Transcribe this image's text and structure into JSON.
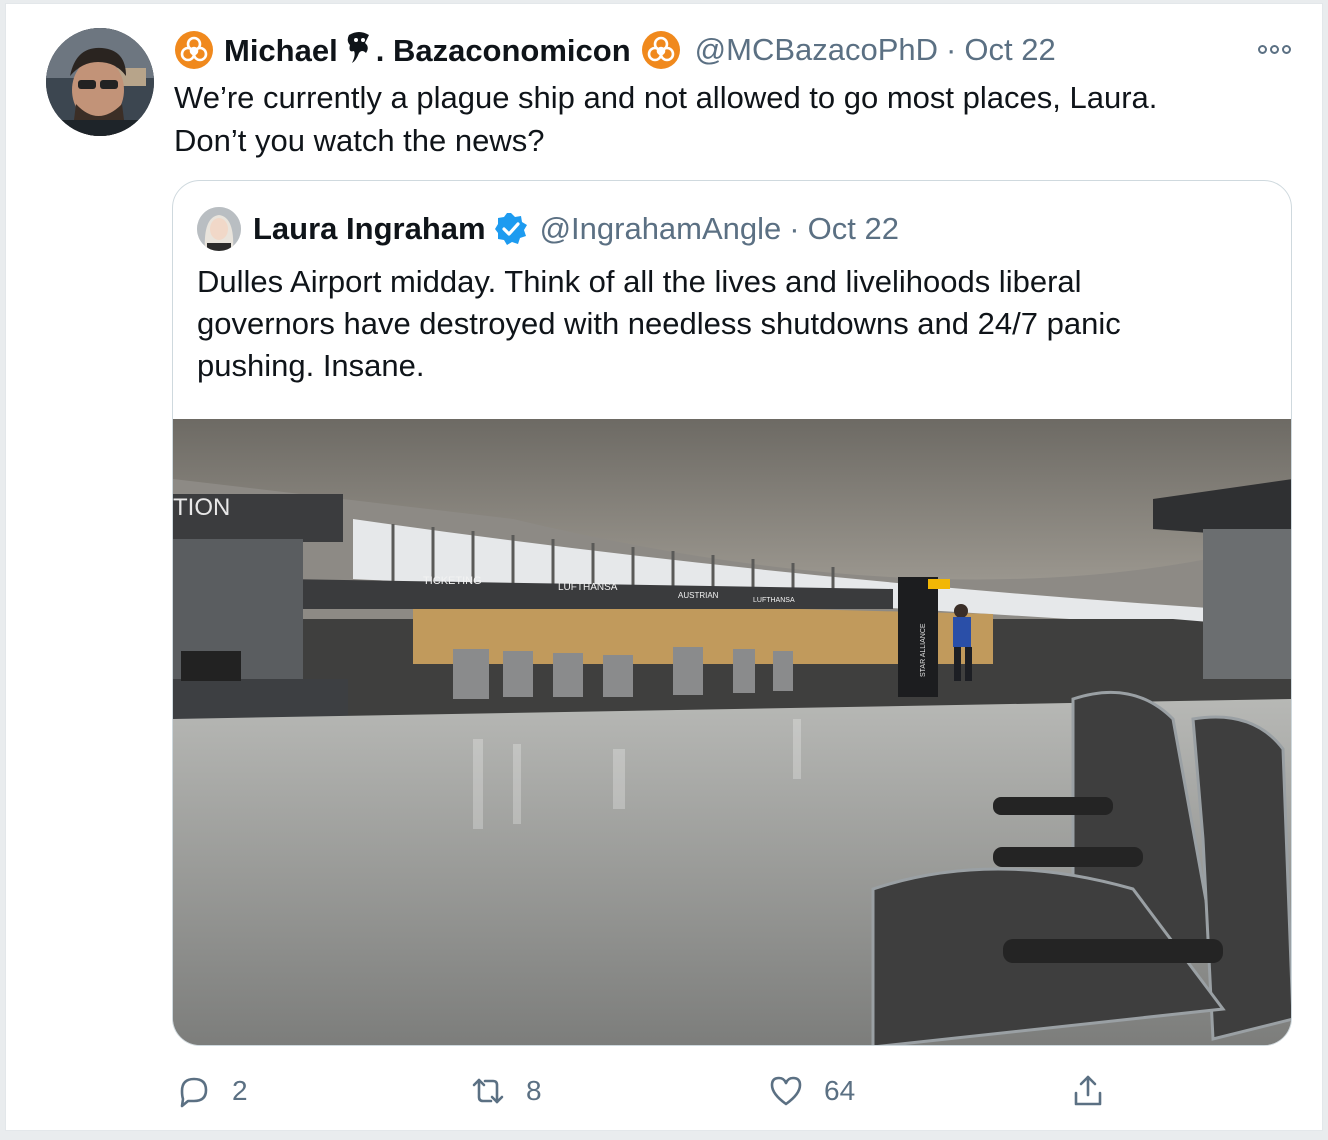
{
  "tweet": {
    "author_name_part1": "Michael",
    "author_name_part2": ". Bazaconomicon",
    "handle": "@MCBazacoPhD",
    "separator": "·",
    "date": "Oct 22",
    "text_line1": "We’re currently a plague ship and not allowed to go most places, Laura.",
    "text_line2": "Don’t you watch the news?",
    "biohazard_color": "#f0891d"
  },
  "quoted": {
    "author_name": "Laura Ingraham",
    "handle": "@IngrahamAngle",
    "separator": "·",
    "date": "Oct 22",
    "text_line1": "Dulles Airport midday.  Think of all the lives and livelihoods liberal",
    "text_line2": "governors have destroyed with needless shutdowns and 24/7 panic",
    "text_line3": "pushing.  Insane.",
    "verified_color": "#1d9bf0",
    "image_text": {
      "sign_tion": "TION",
      "sign_ticketing": "TICKETING",
      "sign_lufthansa": "LUFTHANSA",
      "sign_austrian": "AUSTRIAN",
      "sign_lufthansa_small": "LUFTHANSA",
      "sign_star_alliance": "STAR ALLIANCE"
    }
  },
  "actions": {
    "reply_count": "2",
    "retweet_count": "8",
    "like_count": "64"
  },
  "icons": {
    "more": "more-icon",
    "reply": "reply-icon",
    "retweet": "retweet-icon",
    "like": "heart-icon",
    "share": "share-icon"
  }
}
